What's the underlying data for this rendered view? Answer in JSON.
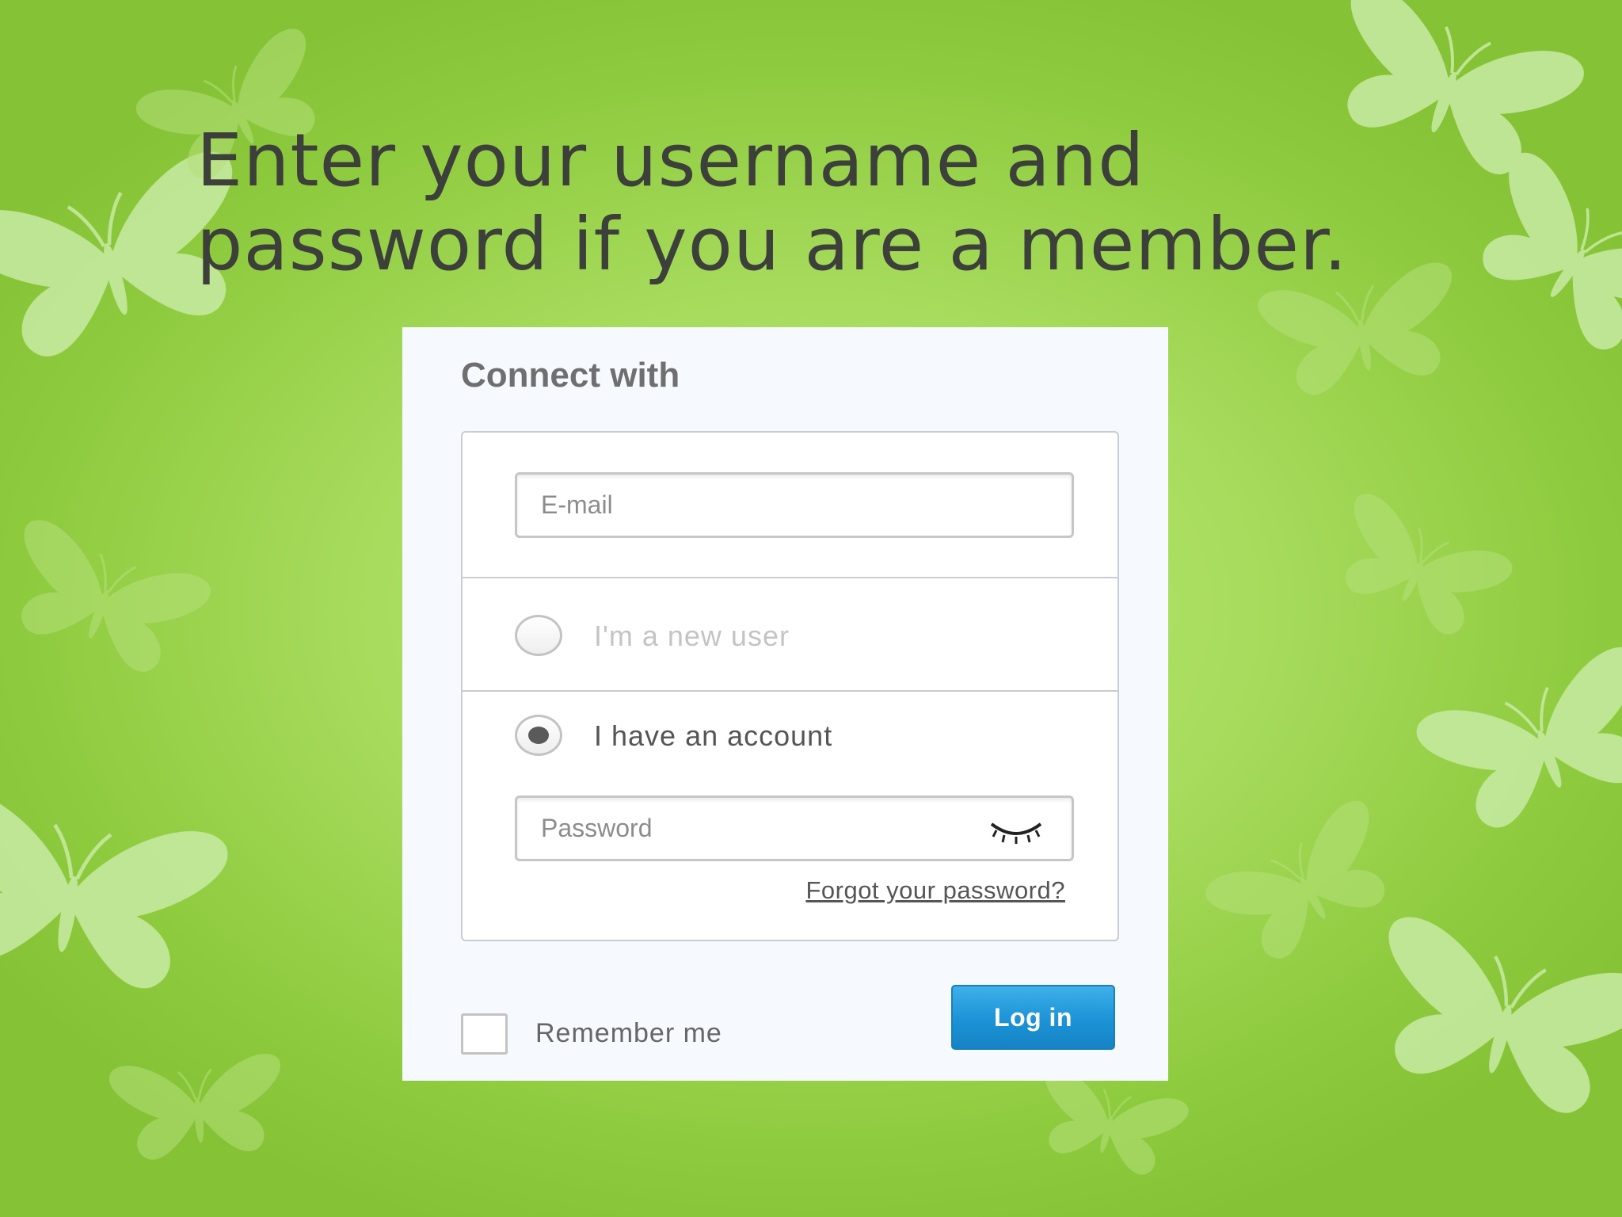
{
  "slide": {
    "title": "Enter your username and password if you are a member."
  },
  "login": {
    "heading": "Connect with",
    "email_placeholder": "E-mail",
    "new_user_label": "I'm a new user",
    "existing_user_label": "I have an account",
    "selected_option": "I have an account",
    "password_placeholder": "Password",
    "forgot_link": "Forgot your password?",
    "remember_label": "Remember me",
    "remember_checked": false,
    "login_button": "Log in"
  },
  "icons": {
    "password_toggle": "eye-closed-icon",
    "background_decoration": "butterfly-icon"
  },
  "colors": {
    "background_green": "#a8dc5e",
    "butterfly": "#c6eaa0",
    "title_text": "#3c3f3a",
    "button_blue": "#1b93d6"
  }
}
